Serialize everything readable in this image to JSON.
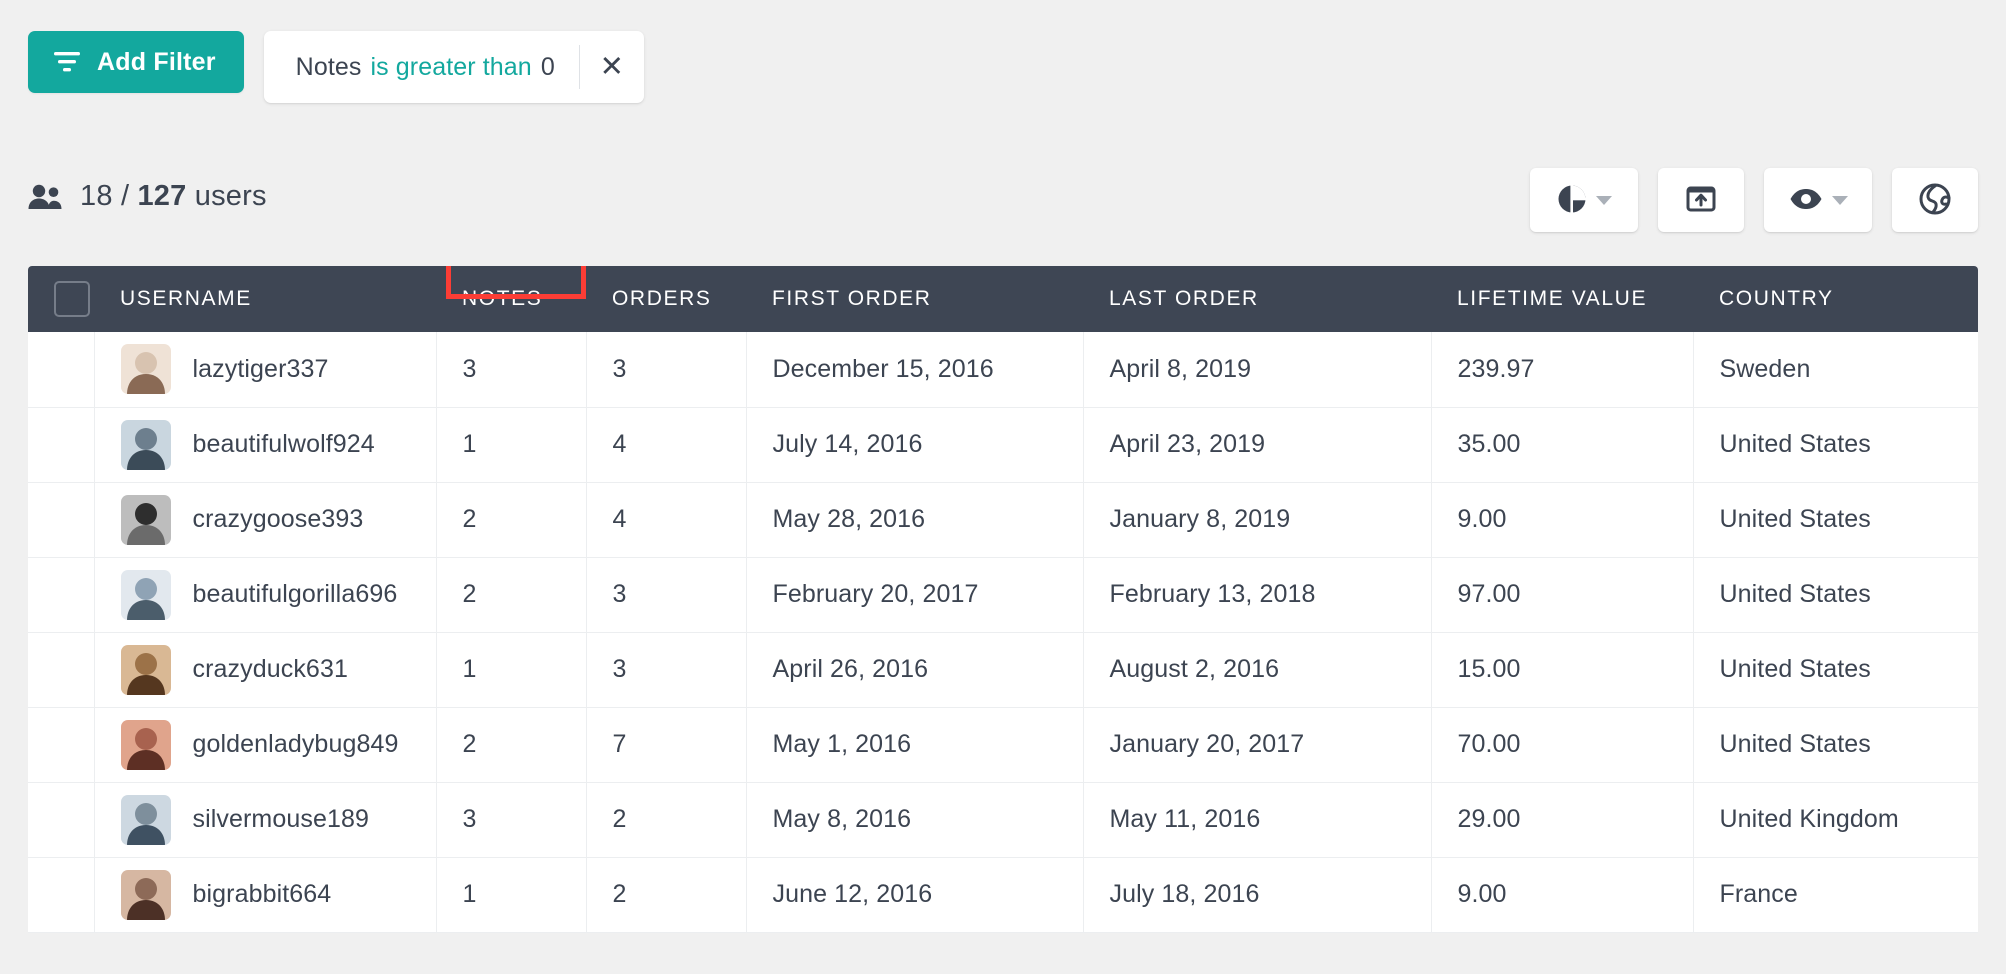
{
  "filter_bar": {
    "add_filter_label": "Add Filter",
    "add_filter_icon": "filter-icon",
    "chip": {
      "field": "Notes",
      "operator": "is greater than",
      "value": "0",
      "close_icon": "close-icon"
    }
  },
  "summary": {
    "icon": "users-icon",
    "shown": "18",
    "separator": "/",
    "total": "127",
    "unit": "users"
  },
  "toolbar": {
    "buttons": [
      {
        "name": "chart-view-button",
        "icon": "pie-chart-icon",
        "has_caret": true
      },
      {
        "name": "export-button",
        "icon": "export-icon",
        "has_caret": false
      },
      {
        "name": "visibility-button",
        "icon": "eye-icon",
        "has_caret": true
      },
      {
        "name": "globe-button",
        "icon": "globe-icon",
        "has_caret": false
      }
    ]
  },
  "table": {
    "select_all_checkbox": "checkbox-unchecked",
    "highlighted_column": "NOTES",
    "highlight_color": "#fc3d35",
    "columns": [
      "USERNAME",
      "NOTES",
      "ORDERS",
      "FIRST ORDER",
      "LAST ORDER",
      "LIFETIME VALUE",
      "COUNTRY"
    ],
    "rows": [
      {
        "username": "lazytiger337",
        "notes": "3",
        "orders": "3",
        "first_order": "December 15, 2016",
        "last_order": "April 8, 2019",
        "lifetime_value": "239.97",
        "country": "Sweden"
      },
      {
        "username": "beautifulwolf924",
        "notes": "1",
        "orders": "4",
        "first_order": "July 14, 2016",
        "last_order": "April 23, 2019",
        "lifetime_value": "35.00",
        "country": "United States"
      },
      {
        "username": "crazygoose393",
        "notes": "2",
        "orders": "4",
        "first_order": "May 28, 2016",
        "last_order": "January 8, 2019",
        "lifetime_value": "9.00",
        "country": "United States"
      },
      {
        "username": "beautifulgorilla696",
        "notes": "2",
        "orders": "3",
        "first_order": "February 20, 2017",
        "last_order": "February 13, 2018",
        "lifetime_value": "97.00",
        "country": "United States"
      },
      {
        "username": "crazyduck631",
        "notes": "1",
        "orders": "3",
        "first_order": "April 26, 2016",
        "last_order": "August 2, 2016",
        "lifetime_value": "15.00",
        "country": "United States"
      },
      {
        "username": "goldenladybug849",
        "notes": "2",
        "orders": "7",
        "first_order": "May 1, 2016",
        "last_order": "January 20, 2017",
        "lifetime_value": "70.00",
        "country": "United States"
      },
      {
        "username": "silvermouse189",
        "notes": "3",
        "orders": "2",
        "first_order": "May 8, 2016",
        "last_order": "May 11, 2016",
        "lifetime_value": "29.00",
        "country": "United Kingdom"
      },
      {
        "username": "bigrabbit664",
        "notes": "1",
        "orders": "2",
        "first_order": "June 12, 2016",
        "last_order": "July 18, 2016",
        "lifetime_value": "9.00",
        "country": "France"
      }
    ]
  },
  "colors": {
    "accent": "#13a89e",
    "header_bg": "#3e4654",
    "text": "#3c4451",
    "page_bg": "#f0f0f0",
    "highlight": "#fc3d35"
  }
}
